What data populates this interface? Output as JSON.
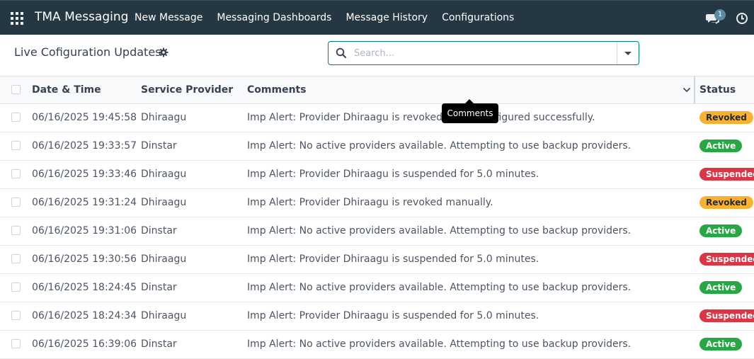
{
  "navbar": {
    "apps_icon": "apps-grid-icon",
    "brand": "TMA Messaging",
    "menu": [
      {
        "label": "New Message"
      },
      {
        "label": "Messaging Dashboards"
      },
      {
        "label": "Message History"
      },
      {
        "label": "Configurations"
      }
    ],
    "chat_icon": "chat-bubbles-icon",
    "chat_badge": "1",
    "activity_icon": "clock-icon"
  },
  "control_panel": {
    "title": "Live Cofiguration Updates",
    "gear_icon": "gear-icon",
    "search_placeholder": "Search...",
    "search_value": ""
  },
  "table": {
    "headers": {
      "date": "Date & Time",
      "provider": "Service Provider",
      "comments": "Comments",
      "status": "Status"
    },
    "rows": [
      {
        "date": "06/16/2025 19:45:58",
        "provider": "Dhiraagu",
        "comment": "Imp Alert: Provider Dhiraagu is revoked and reconfigured successfully.",
        "status": "Revoked",
        "status_key": "revoked"
      },
      {
        "date": "06/16/2025 19:33:57",
        "provider": "Dinstar",
        "comment": "Imp Alert: No active providers available. Attempting to use backup providers.",
        "status": "Active",
        "status_key": "active"
      },
      {
        "date": "06/16/2025 19:33:46",
        "provider": "Dhiraagu",
        "comment": "Imp Alert: Provider Dhiraagu is suspended for 5.0 minutes.",
        "status": "Suspended",
        "status_key": "suspended"
      },
      {
        "date": "06/16/2025 19:31:24",
        "provider": "Dhiraagu",
        "comment": "Imp Alert: Provider Dhiraagu is revoked manually.",
        "status": "Revoked",
        "status_key": "revoked"
      },
      {
        "date": "06/16/2025 19:31:06",
        "provider": "Dinstar",
        "comment": "Imp Alert: No active providers available. Attempting to use backup providers.",
        "status": "Active",
        "status_key": "active"
      },
      {
        "date": "06/16/2025 19:30:56",
        "provider": "Dhiraagu",
        "comment": "Imp Alert: Provider Dhiraagu is suspended for 5.0 minutes.",
        "status": "Suspended",
        "status_key": "suspended"
      },
      {
        "date": "06/16/2025 18:24:45",
        "provider": "Dinstar",
        "comment": "Imp Alert: No active providers available. Attempting to use backup providers.",
        "status": "Active",
        "status_key": "active"
      },
      {
        "date": "06/16/2025 18:24:34",
        "provider": "Dhiraagu",
        "comment": "Imp Alert: Provider Dhiraagu is suspended for 5.0 minutes.",
        "status": "Suspended",
        "status_key": "suspended"
      },
      {
        "date": "06/16/2025 16:39:06",
        "provider": "Dinstar",
        "comment": "Imp Alert: No active providers available. Attempting to use backup providers.",
        "status": "Active",
        "status_key": "active"
      }
    ]
  },
  "tooltip": {
    "text": "Comments"
  },
  "colors": {
    "navbar_bg": "#243742",
    "accent": "#017e84",
    "revoked": "#fbb130",
    "active": "#28a745",
    "suspended": "#dc3545"
  }
}
